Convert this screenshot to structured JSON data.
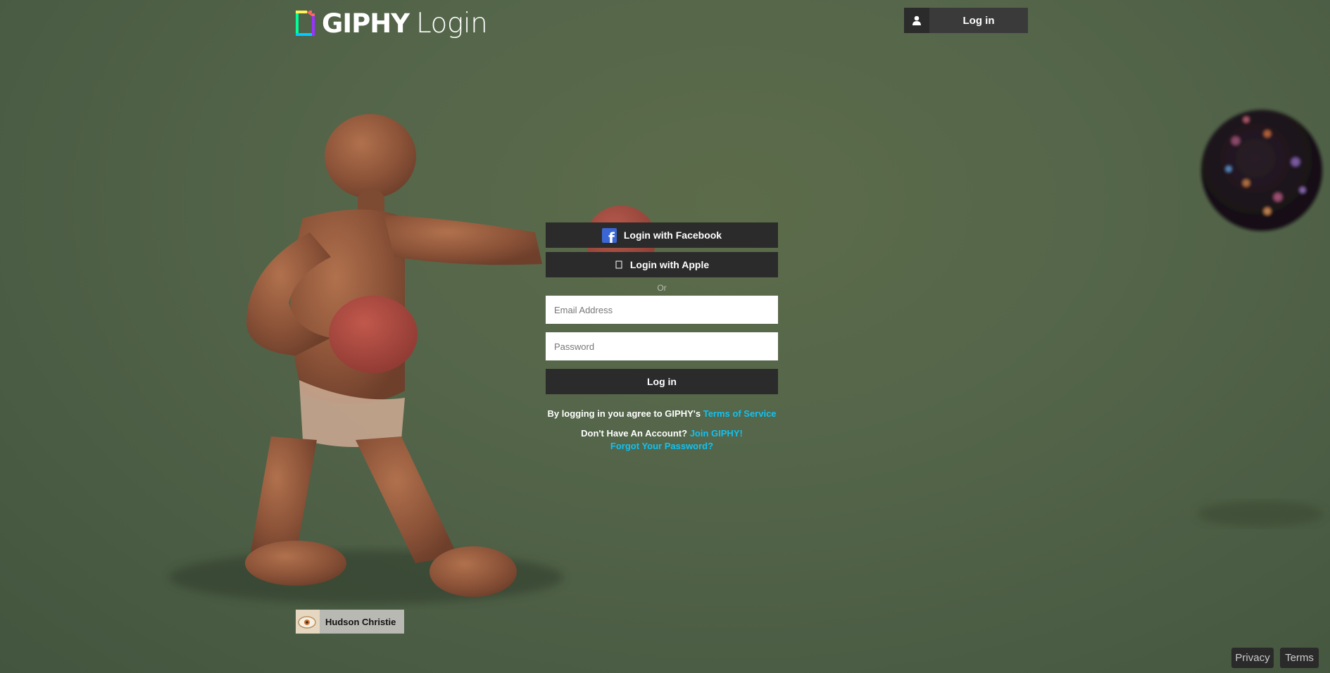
{
  "header": {
    "brand": "GIPHY",
    "page_name": "Login",
    "top_login_label": "Log in"
  },
  "login_form": {
    "facebook_label": "Login with Facebook",
    "apple_label": "Login with Apple",
    "or_text": "Or",
    "email_placeholder": "Email Address",
    "password_placeholder": "Password",
    "submit_label": "Log in",
    "agree_text": "By logging in you agree to GIPHY's",
    "terms_link": "Terms of Service",
    "no_account_text": "Don't Have An Account?",
    "join_link": "Join GIPHY!",
    "forgot_link": "Forgot Your Password?"
  },
  "attribution": {
    "name": "Hudson Christie"
  },
  "footer": {
    "privacy": "Privacy",
    "terms": "Terms"
  },
  "colors": {
    "background": "#55664a",
    "button_dark": "#2b2b2b",
    "link": "#10c2f2",
    "facebook": "#3b66d6"
  },
  "icons": [
    "giphy-logo-icon",
    "user-icon",
    "facebook-icon",
    "apple-icon"
  ]
}
